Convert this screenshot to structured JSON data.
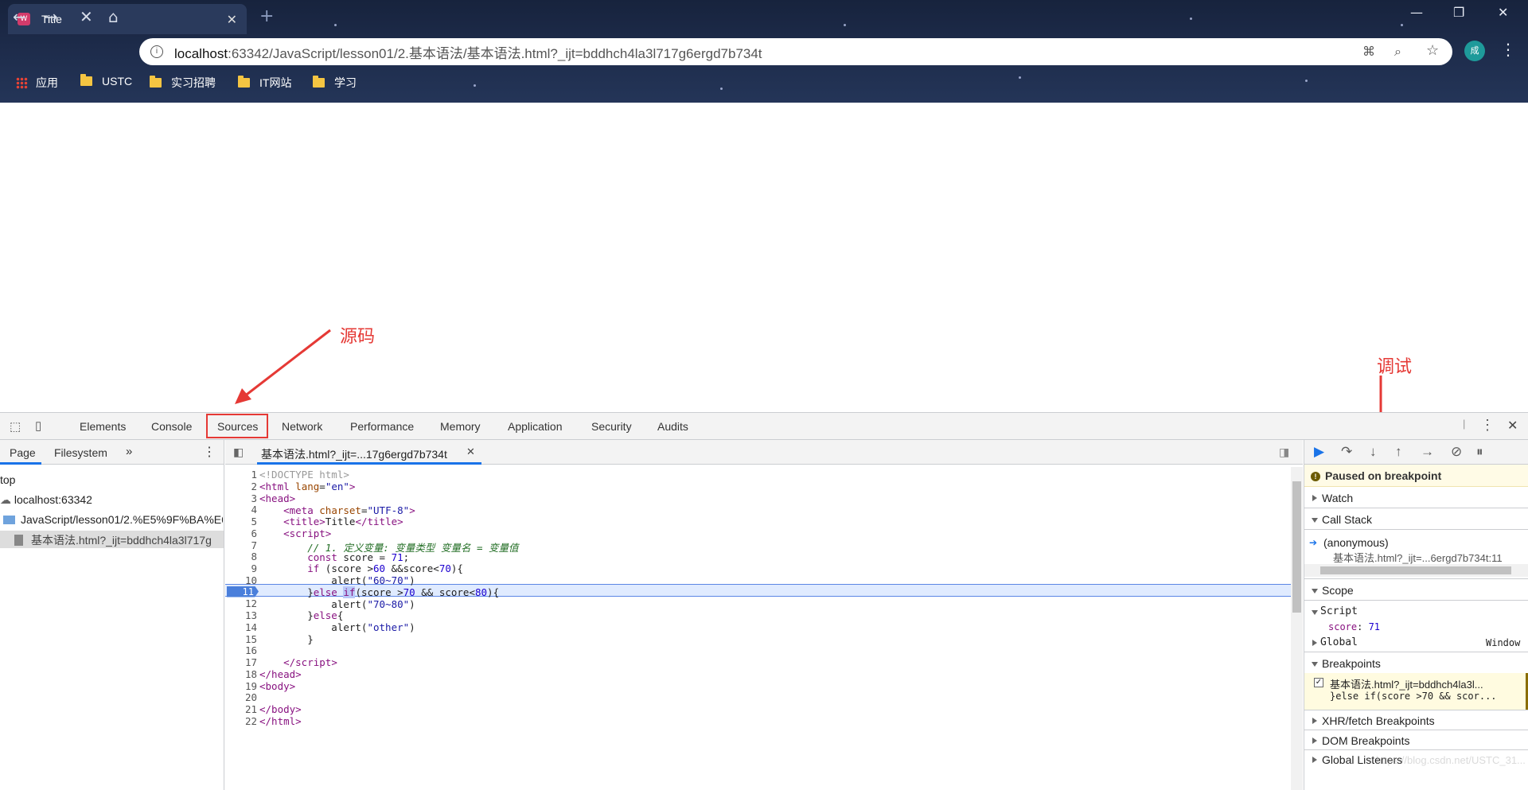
{
  "browser": {
    "tab_title": "Title",
    "url_host": "localhost",
    "url_rest": ":63342/JavaScript/lesson01/2.基本语法/基本语法.html?_ijt=bddhch4la3l717g6ergd7b734t",
    "avatar": "成",
    "bookmarks": [
      "应用",
      "USTC",
      "实习招聘",
      "IT网站",
      "学习"
    ]
  },
  "annotations": {
    "sources": "源码",
    "debug": "调试"
  },
  "devtools": {
    "tabs": [
      "Elements",
      "Console",
      "Sources",
      "Network",
      "Performance",
      "Memory",
      "Application",
      "Security",
      "Audits"
    ],
    "nav_tabs": [
      "Page",
      "Filesystem"
    ],
    "tree": {
      "top": "top",
      "host": "localhost:63342",
      "folder": "JavaScript/lesson01/2.%E5%9F%BA%E6",
      "file": "基本语法.html?_ijt=bddhch4la3l717g"
    },
    "editor_tab": "基本语法.html?_ijt=...17g6ergd7b734t",
    "line_numbers": [
      "1",
      "2",
      "3",
      "4",
      "5",
      "6",
      "7",
      "8",
      "9",
      "10",
      "11",
      "12",
      "13",
      "14",
      "15",
      "16",
      "17",
      "18",
      "19",
      "20",
      "21",
      "22"
    ],
    "current_line": "11",
    "paused": "Paused on breakpoint",
    "watch": "Watch",
    "call_stack": "Call Stack",
    "frame_name": "(anonymous)",
    "frame_loc": "基本语法.html?_ijt=...6ergd7b734t:11",
    "scope": "Scope",
    "script": "Script",
    "score_var": "score",
    "score_val": "71",
    "global": "Global",
    "global_val": "Window",
    "breakpoints": "Breakpoints",
    "bp_file": "基本语法.html?_ijt=bddhch4la3l...",
    "bp_code": "}else if(score >70 && scor...",
    "xhr": "XHR/fetch Breakpoints",
    "dom": "DOM Breakpoints",
    "listeners": "Global Listeners",
    "watermark": "https://blog.csdn.net/USTC_31..."
  }
}
